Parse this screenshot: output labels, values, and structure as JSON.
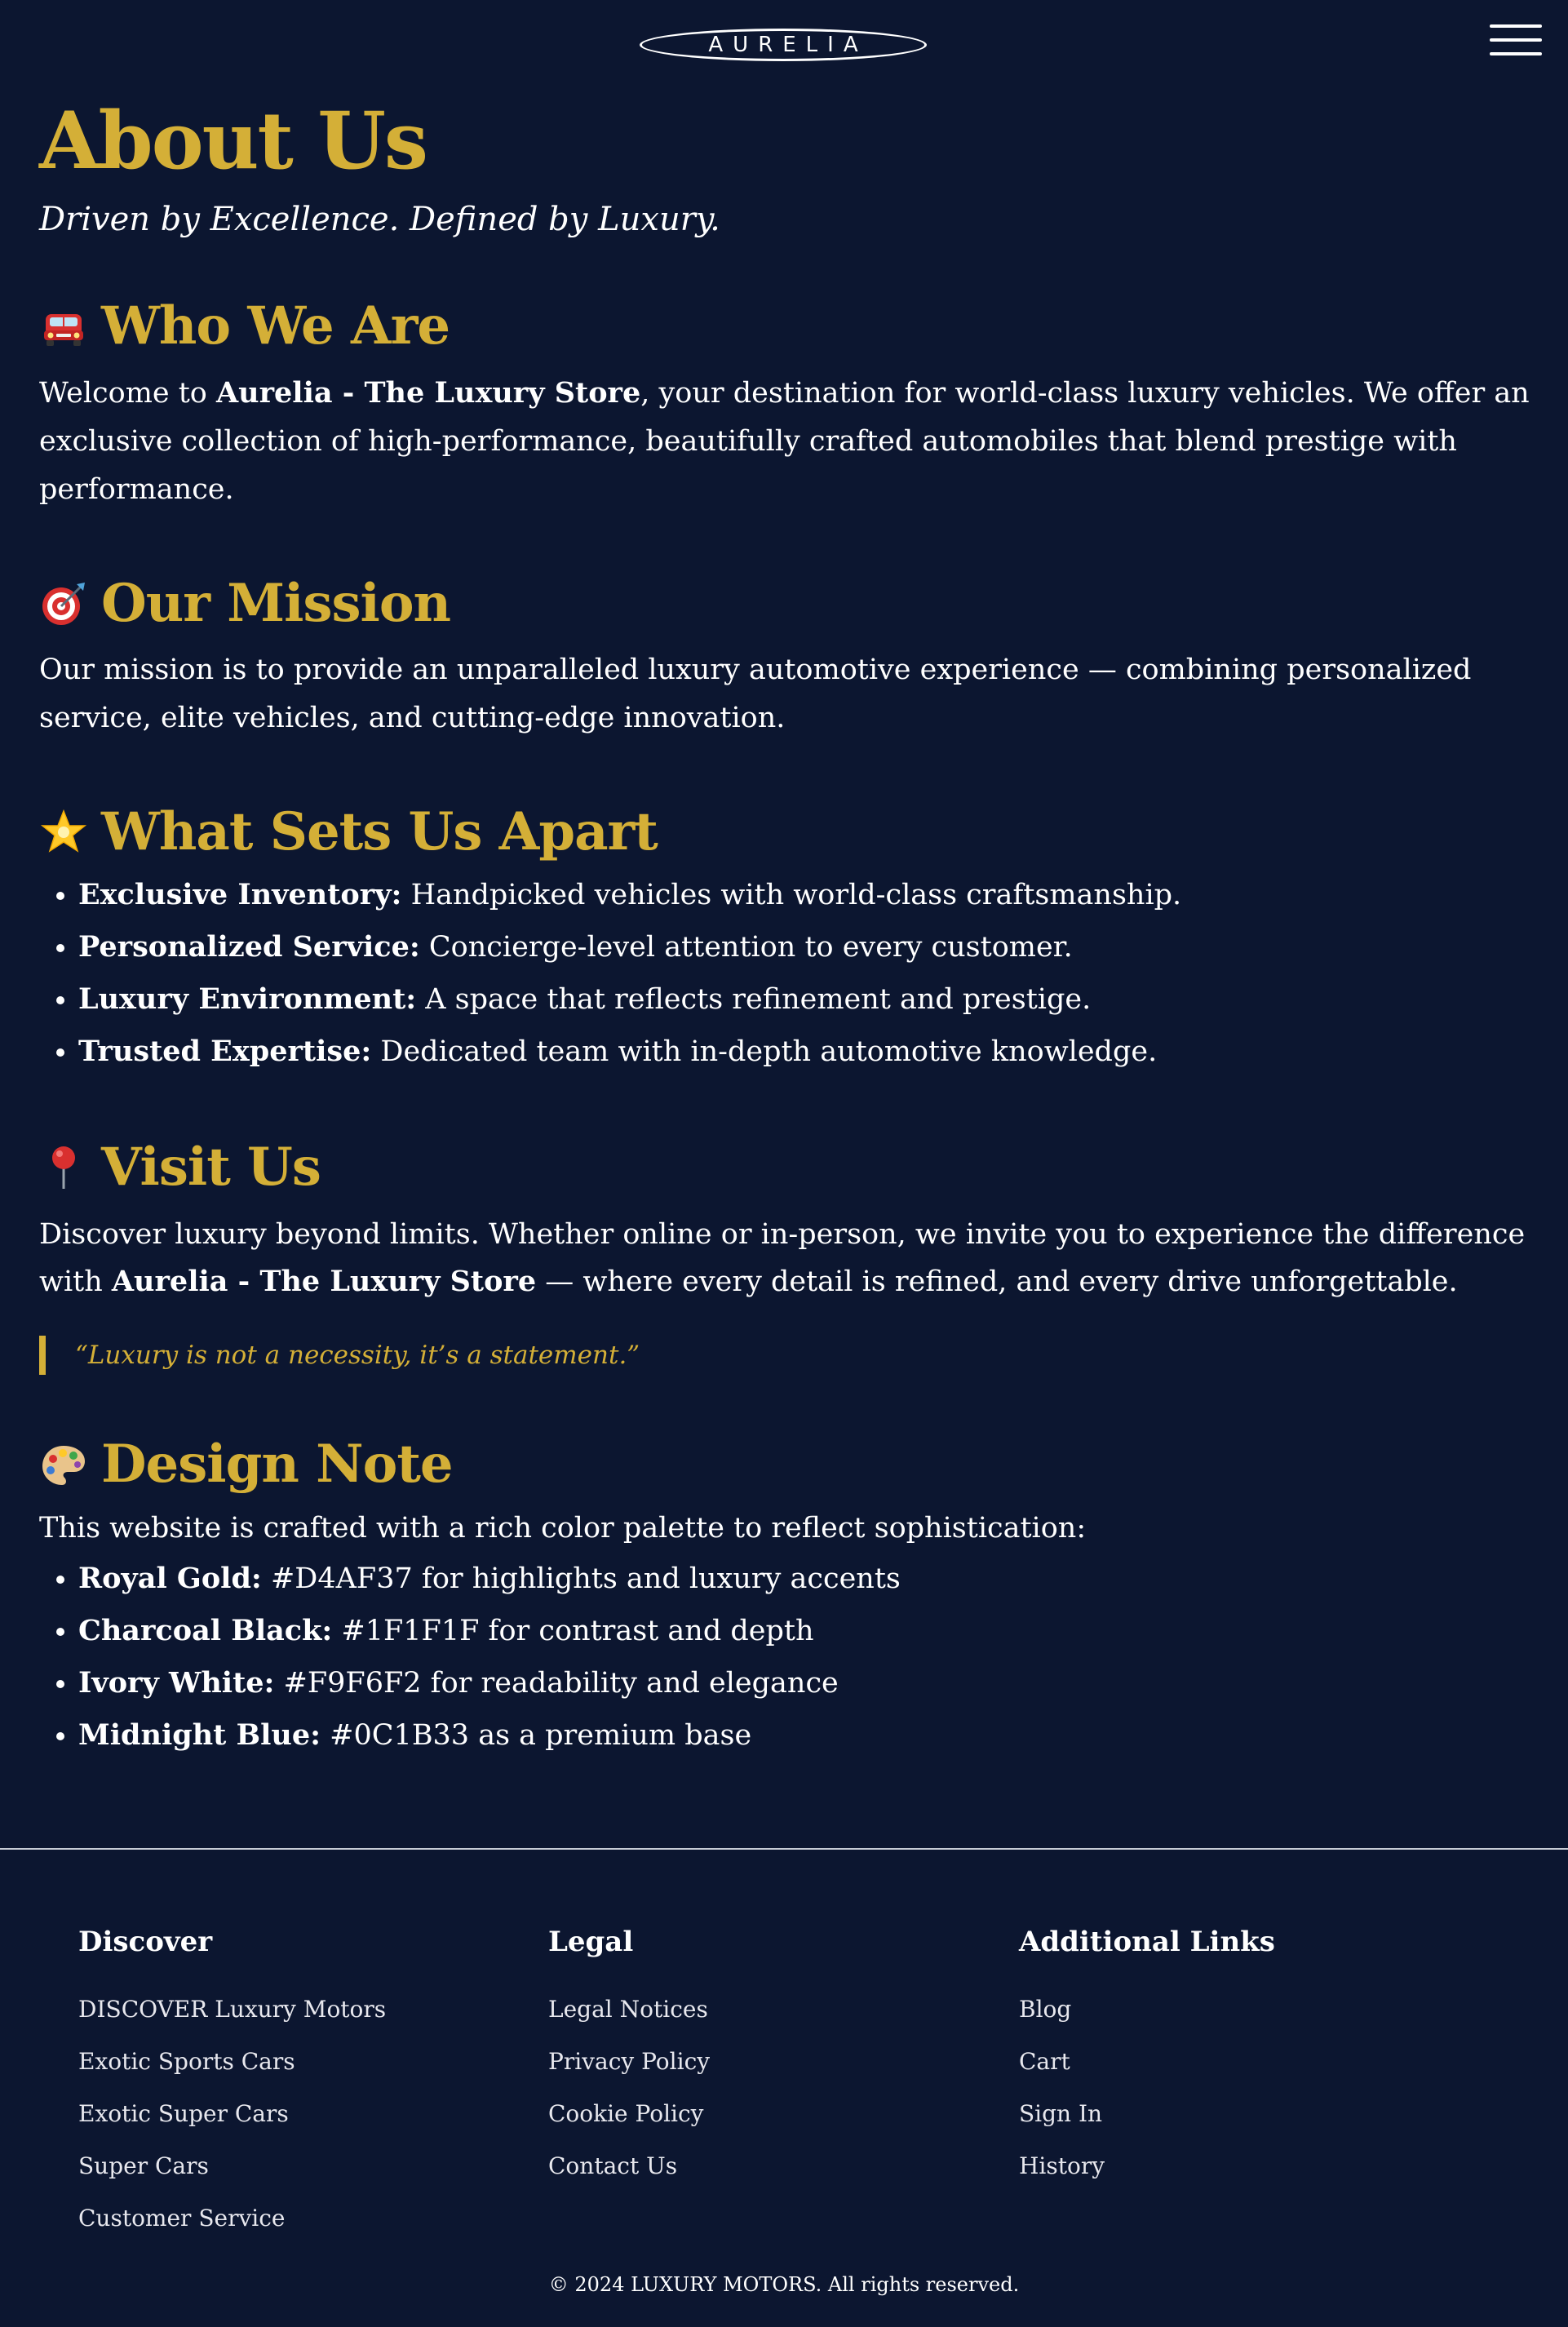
{
  "header": {
    "logo_text": "AURELIA",
    "menu_icon": "hamburger-menu-icon"
  },
  "colors": {
    "background": "#0C1630",
    "accent_gold": "#D4AF37",
    "text": "#FFFFFF"
  },
  "page": {
    "title": "About Us",
    "tagline": "Driven by Excellence. Defined by Luxury."
  },
  "sections": {
    "who": {
      "icon": "car-icon",
      "title": "Who We Are",
      "text_before": "Welcome to ",
      "brand": "Aurelia - The Luxury Store",
      "text_after": ", your destination for world-class luxury vehicles. We offer an exclusive collection of high-performance, beautifully crafted automobiles that blend prestige with performance."
    },
    "mission": {
      "icon": "target-icon",
      "title": "Our Mission",
      "text": "Our mission is to provide an unparalleled luxury automotive experience — combining personalized service, elite vehicles, and cutting-edge innovation."
    },
    "apart": {
      "icon": "star-icon",
      "title": "What Sets Us Apart",
      "items": [
        {
          "label": "Exclusive Inventory:",
          "text": " Handpicked vehicles with world-class craftsmanship."
        },
        {
          "label": "Personalized Service:",
          "text": " Concierge-level attention to every customer."
        },
        {
          "label": "Luxury Environment:",
          "text": " A space that reflects refinement and prestige."
        },
        {
          "label": "Trusted Expertise:",
          "text": " Dedicated team with in-depth automotive knowledge."
        }
      ]
    },
    "visit": {
      "icon": "pushpin-icon",
      "title": "Visit Us",
      "text_before": "Discover luxury beyond limits. Whether online or in-person, we invite you to experience the difference with ",
      "brand": "Aurelia - The Luxury Store",
      "text_after": " — where every detail is refined, and every drive unforgettable.",
      "quote": "“Luxury is not a necessity, it’s a statement.”"
    },
    "design": {
      "icon": "palette-icon",
      "title": "Design Note",
      "intro": "This website is crafted with a rich color palette to reflect sophistication:",
      "items": [
        {
          "label": "Royal Gold:",
          "text": " #D4AF37 for highlights and luxury accents"
        },
        {
          "label": "Charcoal Black:",
          "text": " #1F1F1F for contrast and depth"
        },
        {
          "label": "Ivory White:",
          "text": " #F9F6F2 for readability and elegance"
        },
        {
          "label": "Midnight Blue:",
          "text": " #0C1B33 as a premium base"
        }
      ]
    }
  },
  "footer": {
    "columns": [
      {
        "title": "Discover",
        "links": [
          "DISCOVER Luxury Motors",
          "Exotic Sports Cars",
          "Exotic Super Cars",
          "Super Cars",
          "Customer Service"
        ]
      },
      {
        "title": "Legal",
        "links": [
          "Legal Notices",
          "Privacy Policy",
          "Cookie Policy",
          "Contact Us"
        ]
      },
      {
        "title": "Additional Links",
        "links": [
          "Blog",
          "Cart",
          "Sign In",
          "History"
        ]
      }
    ],
    "copyright": "© 2024 LUXURY MOTORS. All rights reserved."
  }
}
